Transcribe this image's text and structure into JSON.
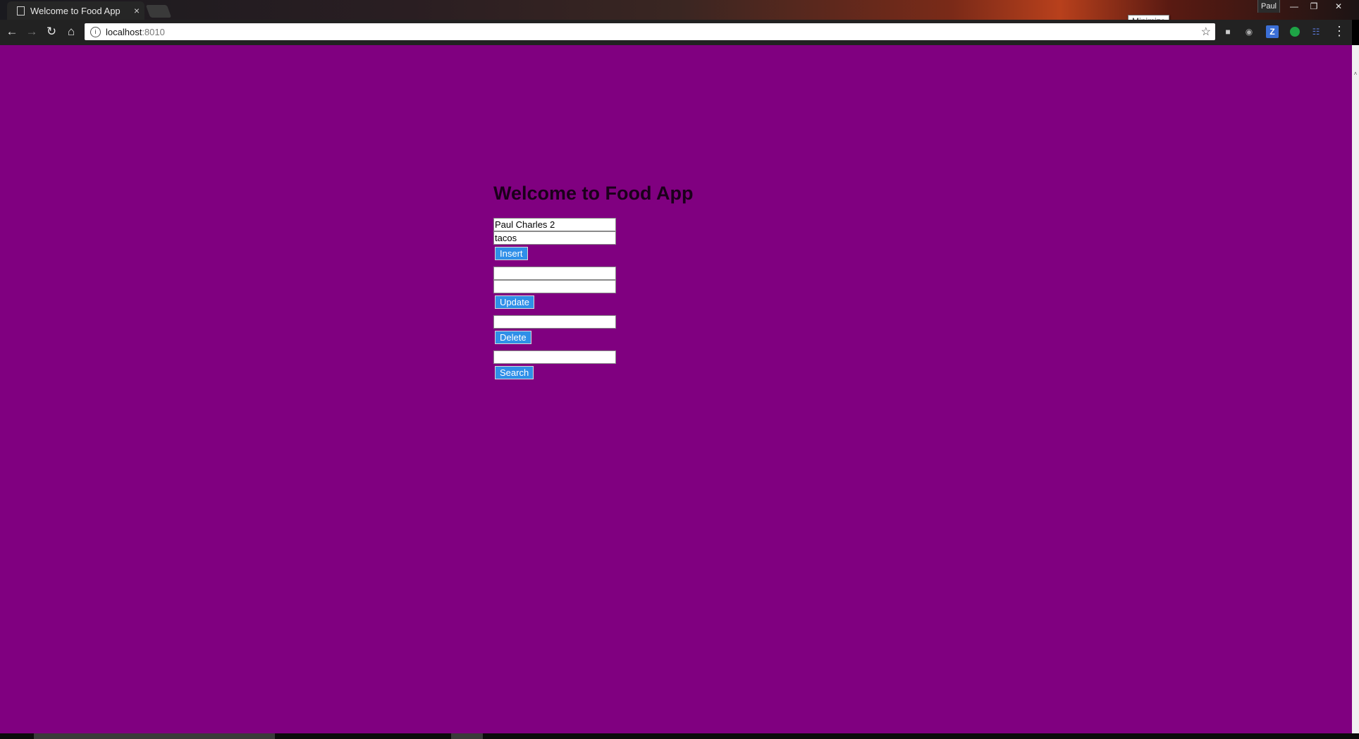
{
  "browser": {
    "tab_title": "Welcome to Food App",
    "tab_close": "×",
    "profile_name": "Paul",
    "tooltip": "Minimize",
    "url_host": "localhost",
    "url_port": ":8010",
    "extension_z": "Z"
  },
  "page": {
    "background_color": "#800080",
    "title": "Welcome to Food App",
    "insert": {
      "name_value": "Paul Charles 2",
      "food_value": "tacos",
      "button_label": "Insert"
    },
    "update": {
      "field1_value": "",
      "field2_value": "",
      "button_label": "Update"
    },
    "delete": {
      "field_value": "",
      "button_label": "Delete"
    },
    "search": {
      "field_value": "",
      "button_label": "Search"
    }
  }
}
